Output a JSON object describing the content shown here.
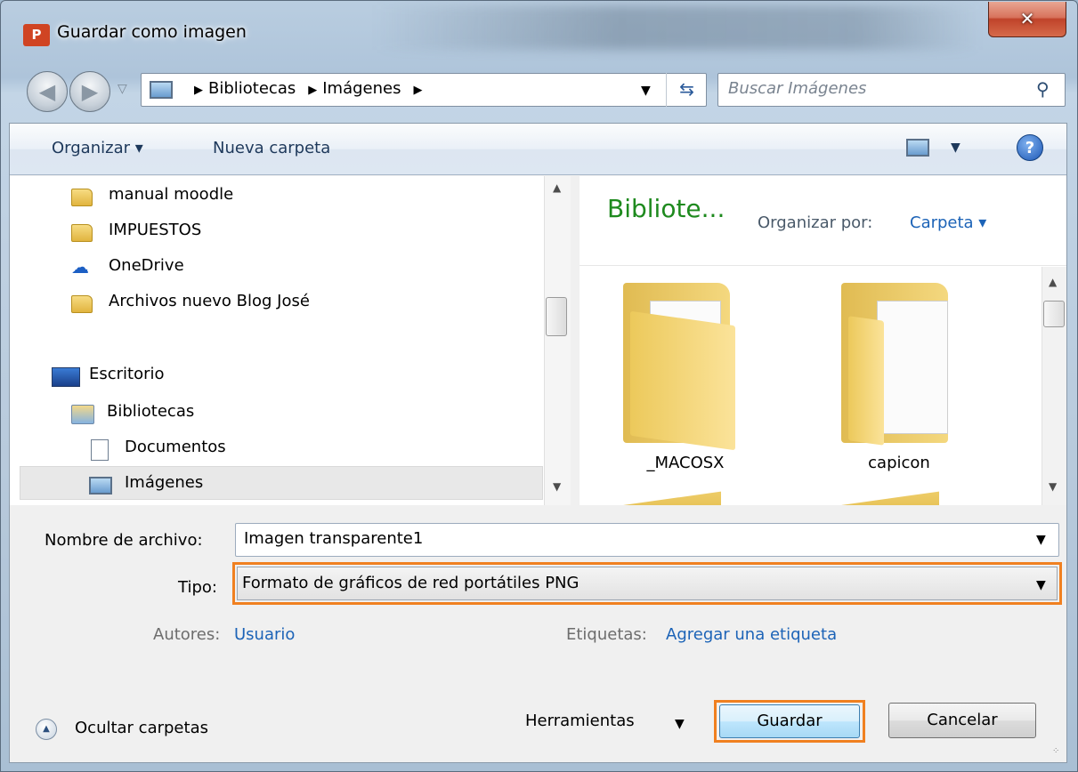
{
  "window": {
    "title": "Guardar como imagen",
    "app_icon_text": "P",
    "close_symbol": "✕"
  },
  "nav": {
    "breadcrumb": [
      "Bibliotecas",
      "Imágenes"
    ],
    "search_placeholder": "Buscar Imágenes"
  },
  "toolbar": {
    "organize_label": "Organizar ▾",
    "new_folder_label": "Nueva carpeta",
    "help_symbol": "?"
  },
  "tree": {
    "items": [
      {
        "label": "manual moodle",
        "icon": "folder-icon"
      },
      {
        "label": "IMPUESTOS",
        "icon": "folder-icon"
      },
      {
        "label": "OneDrive",
        "icon": "onedrive-icon"
      },
      {
        "label": "Archivos nuevo Blog José",
        "icon": "folder-icon"
      },
      {
        "label": "Escritorio",
        "icon": "desktop-icon"
      },
      {
        "label": "Bibliotecas",
        "icon": "libraries-icon"
      },
      {
        "label": "Documentos",
        "icon": "document-icon"
      },
      {
        "label": "Imágenes",
        "icon": "pictures-icon",
        "selected": true
      }
    ]
  },
  "content": {
    "library_title": "Bibliote...",
    "arrange_by_label": "Organizar por:",
    "arrange_by_value": "Carpeta ▾",
    "folders": [
      "_MACOSX",
      "capicon"
    ]
  },
  "form": {
    "filename_label": "Nombre de archivo:",
    "filename_value": "Imagen transparente1",
    "type_label": "Tipo:",
    "type_value": "Formato de gráficos de red portátiles PNG",
    "authors_label": "Autores:",
    "authors_value": "Usuario",
    "tags_label": "Etiquetas:",
    "tags_value": "Agregar una etiqueta"
  },
  "footer": {
    "hide_folders_label": "Ocultar carpetas",
    "tools_label": "Herramientas",
    "save_label": "Guardar",
    "cancel_label": "Cancelar"
  },
  "colors": {
    "highlight": "#f08020",
    "link": "#1c63b7",
    "library_title": "#1e8a1e"
  }
}
